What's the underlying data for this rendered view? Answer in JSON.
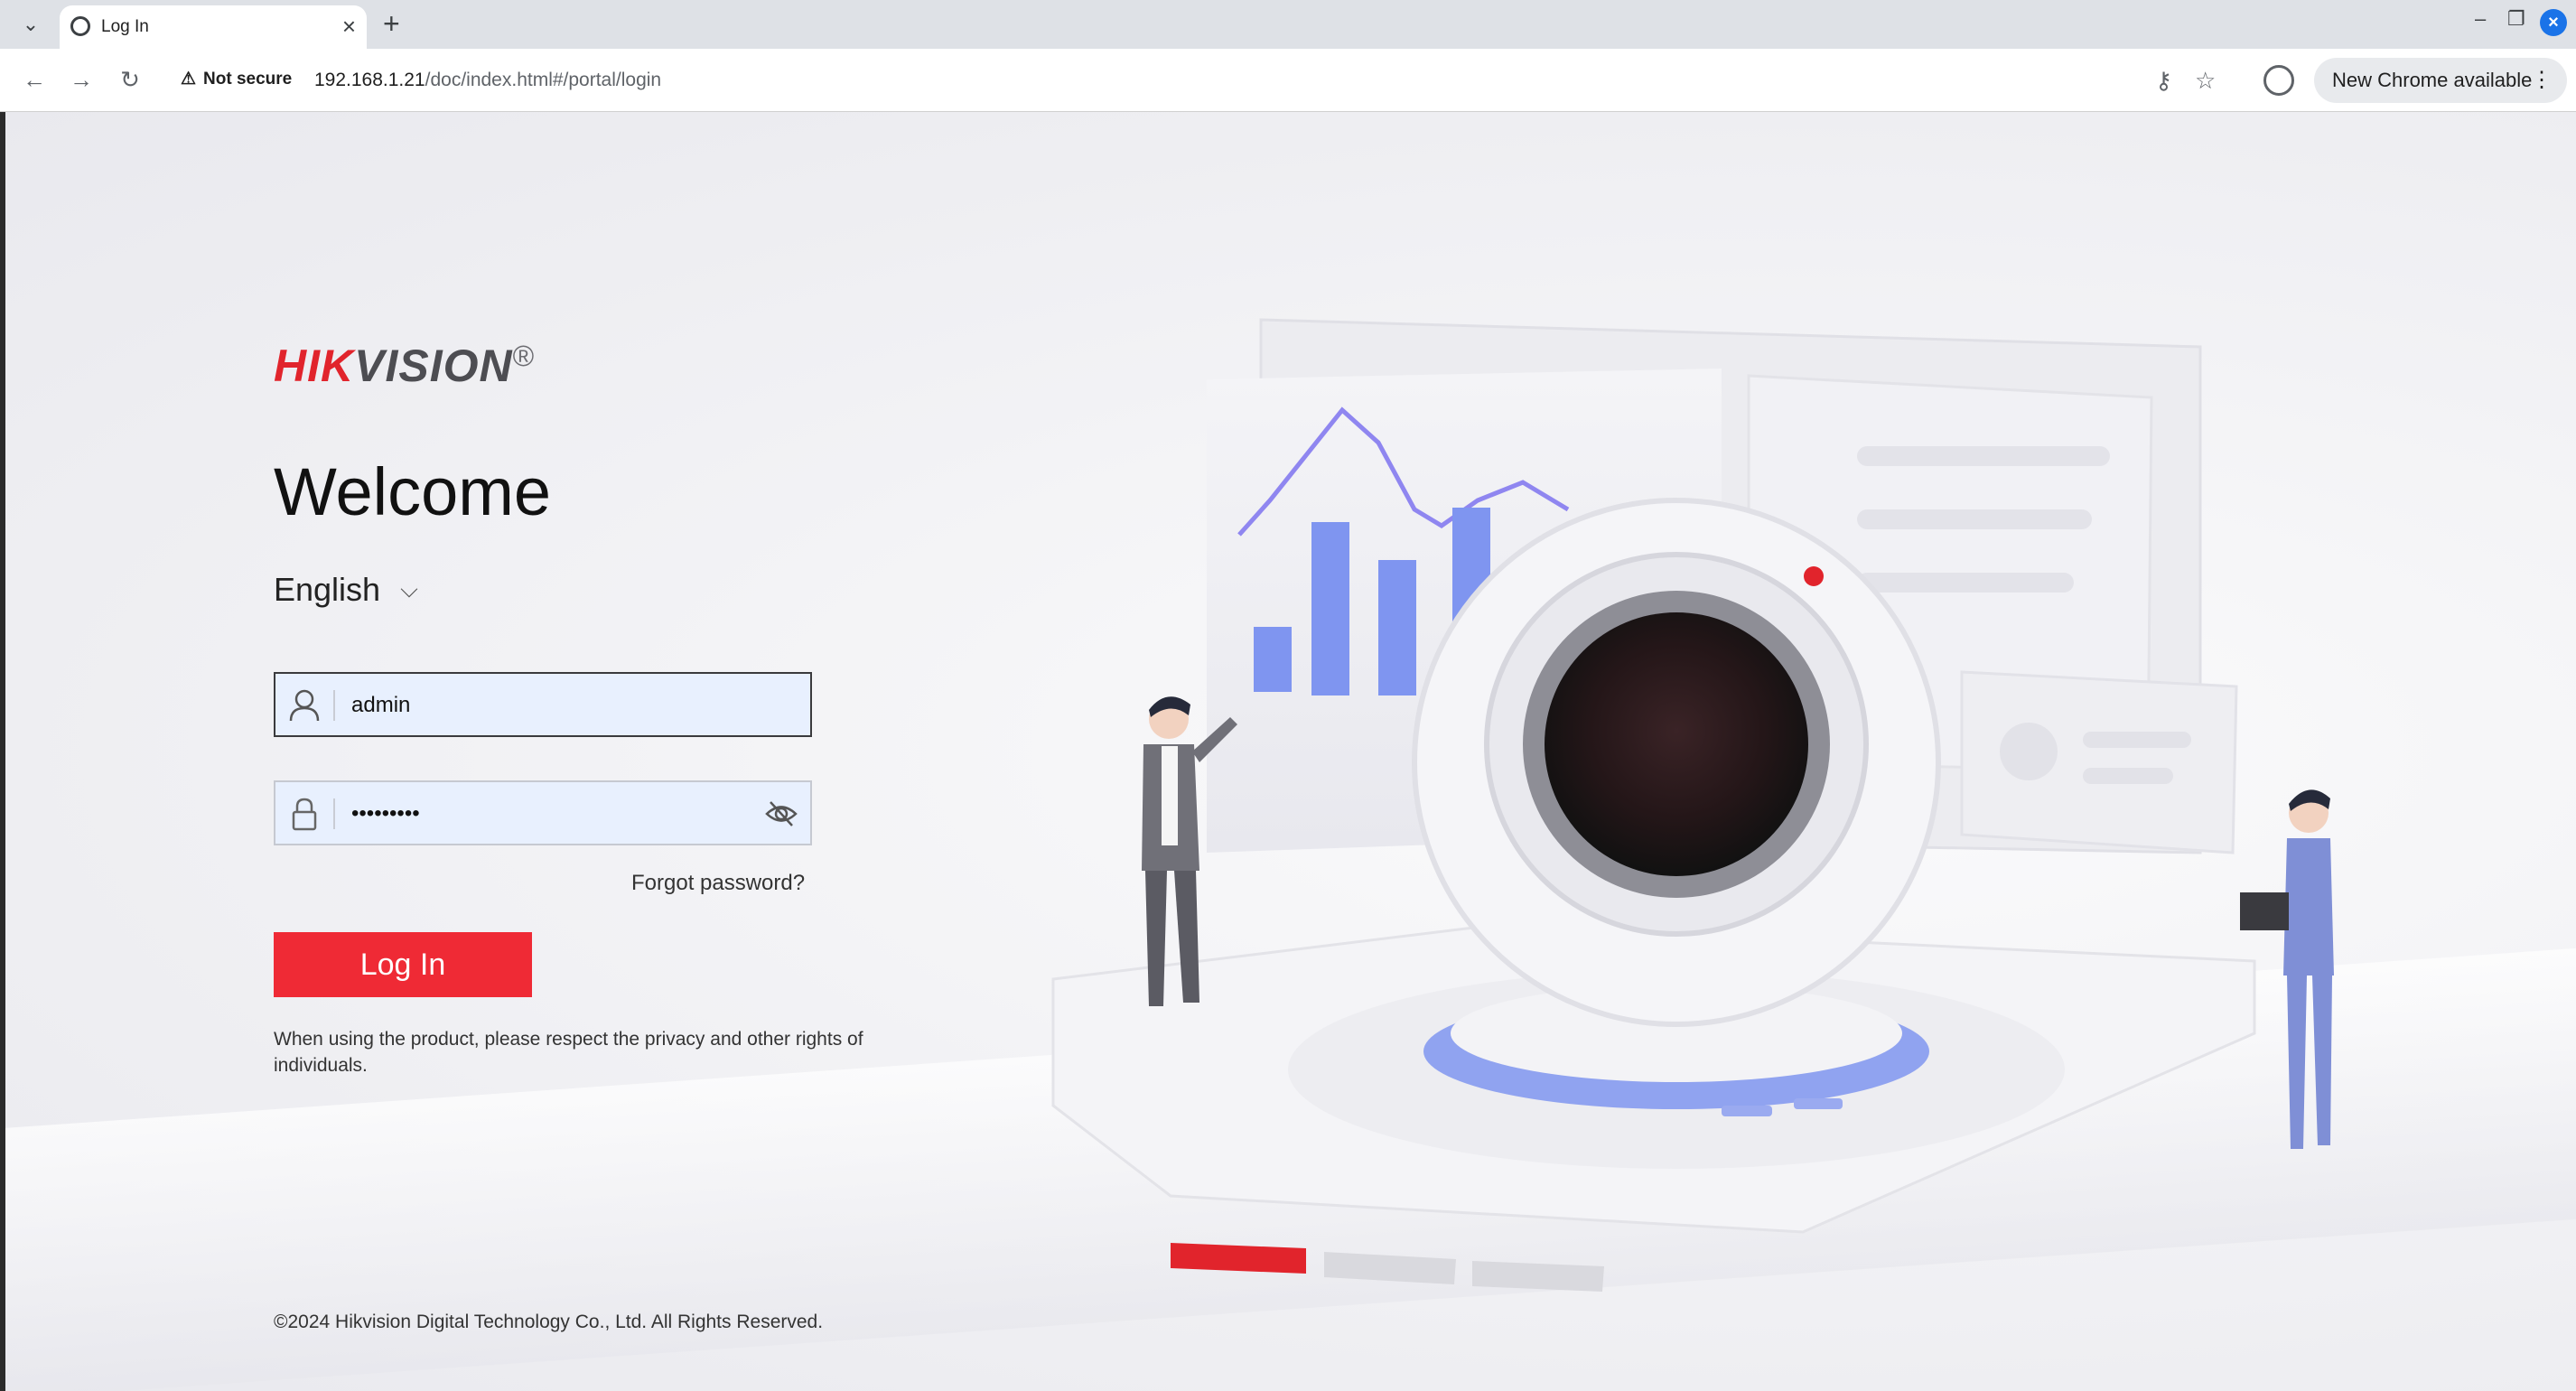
{
  "browser": {
    "tab_title": "Log In",
    "not_secure_label": "Not secure",
    "url_host": "192.168.1.21",
    "url_path": "/doc/index.html#/portal/login",
    "update_label": "New Chrome available",
    "icons": [
      "tab-search-icon",
      "close-icon",
      "plus-icon",
      "back-icon",
      "forward-icon",
      "reload-icon",
      "warning-icon",
      "password-key-icon",
      "star-icon",
      "profile-icon",
      "more-icon",
      "minimize-icon",
      "restore-icon"
    ]
  },
  "login": {
    "brand_hik": "HIK",
    "brand_vision": "VISION",
    "brand_reg": "®",
    "welcome": "Welcome",
    "language": "English",
    "username_value": "admin",
    "password_value": "•••••••••",
    "forgot_password": "Forgot password?",
    "login_button": "Log In",
    "privacy_notice": "When using the product, please respect the privacy and other rights of individuals.",
    "copyright": "©2024 Hikvision Digital Technology Co., Ltd. All Rights Reserved.",
    "colors": {
      "brand_red": "#e1242c",
      "button_red": "#ef2a35",
      "input_fill": "#e8f0fe",
      "accent_blue": "#7f95f0"
    }
  }
}
